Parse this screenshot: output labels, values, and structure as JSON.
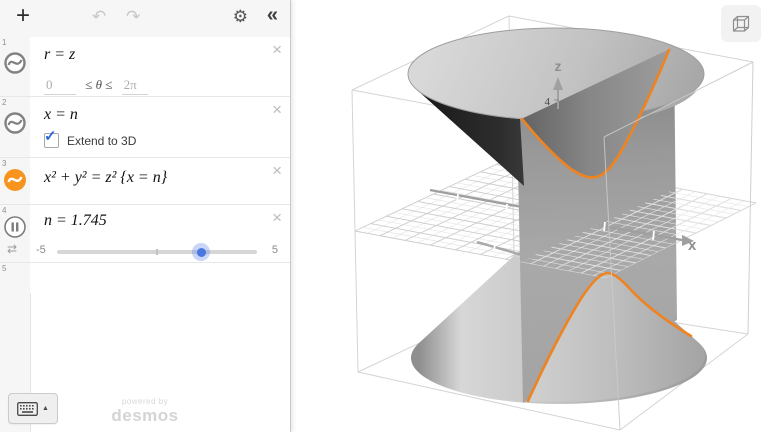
{
  "toolbar": {
    "add": "+",
    "undo": "↶",
    "redo": "↷",
    "settings": "⚙",
    "collapse": "«"
  },
  "rows": [
    {
      "num": "1",
      "latex": "r = z",
      "close": "×",
      "domain": {
        "min": "0",
        "middle": "≤ θ ≤",
        "max": "2π"
      }
    },
    {
      "num": "2",
      "latex": "x = n",
      "close": "×",
      "checkbox_label": "Extend to 3D",
      "checked": true
    },
    {
      "num": "3",
      "latex": "x² + y² = z² {x = n}",
      "close": "×"
    },
    {
      "num": "4",
      "latex": "n = 1.745",
      "close": "×",
      "slider": {
        "min": "-5",
        "max": "5",
        "value": "1.745"
      }
    },
    {
      "num": "5"
    }
  ],
  "icons": {
    "checkmark": "✓",
    "loop": "⇄",
    "keyboard_arrow": "▲"
  },
  "footer": {
    "powered_by": "powered by",
    "brand": "desmos"
  },
  "graph": {
    "x_label": "x",
    "z_label": "z",
    "z_tick": "4",
    "curve_color": "#ef8320",
    "accent_blue": "#4a77e0",
    "n_value": "1.745"
  }
}
